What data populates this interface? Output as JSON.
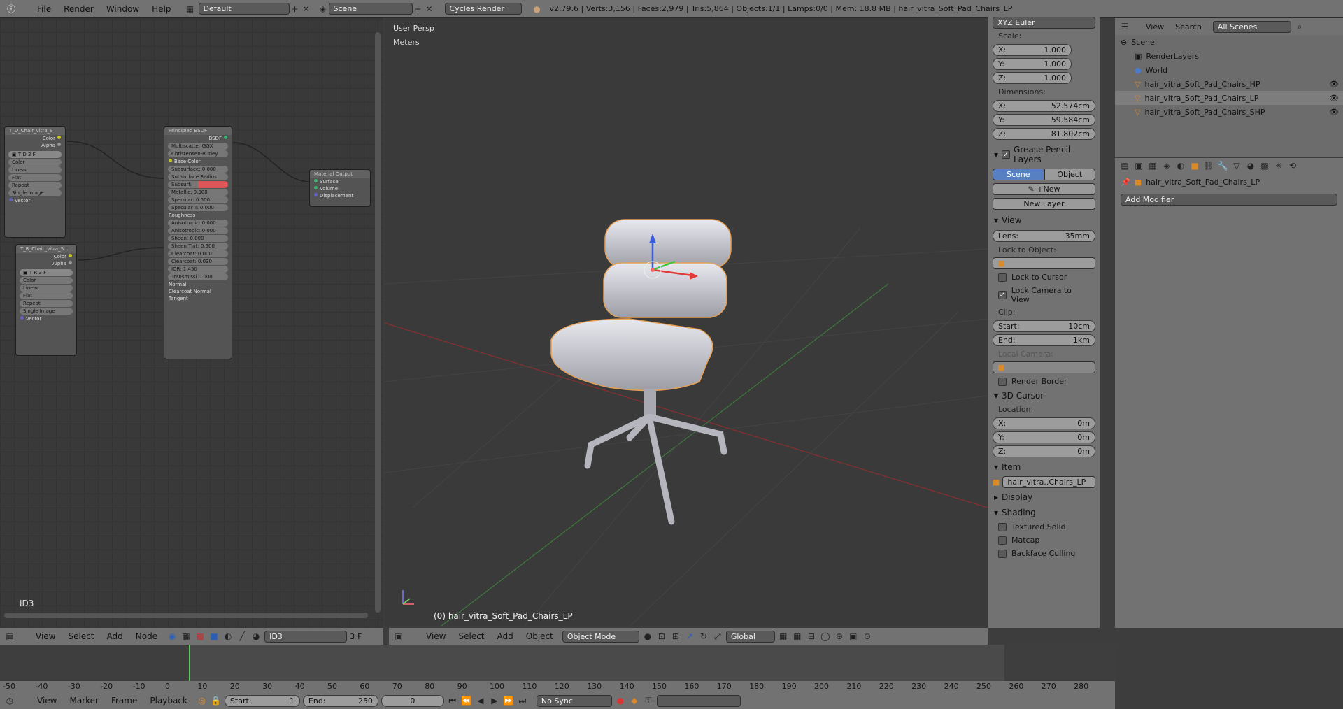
{
  "topbar": {
    "menus": [
      "File",
      "Render",
      "Window",
      "Help"
    ],
    "layout": "Default",
    "scene": "Scene",
    "engine": "Cycles Render",
    "stats": "v2.79.6 | Verts:3,156 | Faces:2,979 | Tris:5,864 | Objects:1/1 | Lamps:0/0 | Mem: 18.8 MB | hair_vitra_Soft_Pad_Chairs_LP"
  },
  "node_editor": {
    "nodes": {
      "tex1": {
        "title": "T_D_Chair_vitra_S",
        "out1": "Color",
        "out2": "Alpha",
        "opts": [
          "Color",
          "Linear",
          "Flat",
          "Repeat",
          "Single Image"
        ],
        "in": "Vector"
      },
      "tex2": {
        "title": "T_R_Chair_vitra_S...",
        "out1": "Color",
        "out2": "Alpha",
        "opts": [
          "Color",
          "Linear",
          "Flat",
          "Repeat",
          "Single Image"
        ],
        "in": "Vector"
      },
      "bsdf": {
        "title": "Principled BSDF",
        "out": "BSDF",
        "dist": "Multiscatter GGX",
        "sss": "Christensen-Burley",
        "base": "Base Color",
        "rows": [
          "Subsurface: 0.000",
          "Subsurface Radius",
          "Subsurf:",
          "Metallic: 0.308",
          "Specular: 0.500",
          "Specular T: 0.000",
          "Roughness",
          "Anisotropic: 0.000",
          "Anisotropic: 0.000",
          "Sheen: 0.000",
          "Sheen Tint: 0.500",
          "Clearcoat: 0.000",
          "Clearcoat: 0.030",
          "IOR: 1.450",
          "Transmissi 0.000",
          "Normal",
          "Clearcoat Normal",
          "Tangent"
        ]
      },
      "output": {
        "title": "Material Output",
        "rows": [
          "Surface",
          "Volume",
          "Displacement"
        ]
      }
    },
    "material_label": "ID3",
    "footer_menus": [
      "View",
      "Select",
      "Add",
      "Node"
    ],
    "material_field": "ID3",
    "users": "3",
    "fake": "F"
  },
  "viewport": {
    "persp": "User Persp",
    "units": "Meters",
    "object_label": "(0) hair_vitra_Soft_Pad_Chairs_LP",
    "footer_menus": [
      "View",
      "Select",
      "Add",
      "Object"
    ],
    "mode": "Object Mode",
    "orientation": "Global"
  },
  "n_panel": {
    "rotation_mode": "XYZ Euler",
    "scale_label": "Scale:",
    "scale": [
      {
        "k": "X:",
        "v": "1.000"
      },
      {
        "k": "Y:",
        "v": "1.000"
      },
      {
        "k": "Z:",
        "v": "1.000"
      }
    ],
    "dimensions_label": "Dimensions:",
    "dimensions": [
      {
        "k": "X:",
        "v": "52.574cm"
      },
      {
        "k": "Y:",
        "v": "59.584cm"
      },
      {
        "k": "Z:",
        "v": "81.802cm"
      }
    ],
    "grease": "Grease Pencil Layers",
    "gp_scene": "Scene",
    "gp_object": "Object",
    "gp_new": "New",
    "gp_new_layer": "New Layer",
    "view": "View",
    "lens_k": "Lens:",
    "lens_v": "35mm",
    "lock_to_object": "Lock to Object:",
    "lock_to_cursor": "Lock to Cursor",
    "lock_camera": "Lock Camera to View",
    "clip": "Clip:",
    "clip_start_k": "Start:",
    "clip_start_v": "10cm",
    "clip_end_k": "End:",
    "clip_end_v": "1km",
    "local_camera": "Local Camera:",
    "render_border": "Render Border",
    "cursor": "3D Cursor",
    "location": "Location:",
    "cursor_loc": [
      {
        "k": "X:",
        "v": "0m"
      },
      {
        "k": "Y:",
        "v": "0m"
      },
      {
        "k": "Z:",
        "v": "0m"
      }
    ],
    "item": "Item",
    "item_name": "hair_vitra..Chairs_LP",
    "display": "Display",
    "shading": "Shading",
    "textured_solid": "Textured Solid",
    "matcap": "Matcap",
    "backface": "Backface Culling"
  },
  "outliner": {
    "menus": [
      "View",
      "Search"
    ],
    "filter": "All Scenes",
    "items": [
      "Scene",
      "RenderLayers",
      "World",
      "hair_vitra_Soft_Pad_Chairs_HP",
      "hair_vitra_Soft_Pad_Chairs_LP",
      "hair_vitra_Soft_Pad_Chairs_SHP"
    ]
  },
  "properties": {
    "object": "hair_vitra_Soft_Pad_Chairs_LP",
    "add_modifier": "Add Modifier"
  },
  "timeline": {
    "ticks": [
      "-50",
      "-40",
      "-30",
      "-20",
      "-10",
      "0",
      "10",
      "20",
      "30",
      "40",
      "50",
      "60",
      "70",
      "80",
      "90",
      "100",
      "110",
      "120",
      "130",
      "140",
      "150",
      "160",
      "170",
      "180",
      "190",
      "200",
      "210",
      "220",
      "230",
      "240",
      "250",
      "260",
      "270",
      "280"
    ],
    "menus": [
      "View",
      "Marker",
      "Frame",
      "Playback"
    ],
    "start_k": "Start:",
    "start_v": "1",
    "end_k": "End:",
    "end_v": "250",
    "current": "0",
    "sync": "No Sync"
  }
}
